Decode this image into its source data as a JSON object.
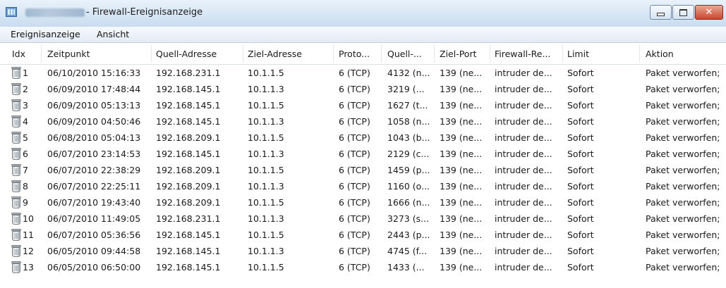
{
  "window": {
    "title": "- Firewall-Ereignisanzeige",
    "controls": {
      "minimize": "minimize",
      "maximize": "maximize",
      "close": "close"
    }
  },
  "menu": [
    "Ereignisanzeige",
    "Ansicht"
  ],
  "columns": {
    "idx": "Idx",
    "time": "Zeitpunkt",
    "src": "Quell-Adresse",
    "dst": "Ziel-Adresse",
    "proto": "Proto...",
    "sport": "Quell-...",
    "dport": "Ziel-Port",
    "rule": "Firewall-Re...",
    "limit": "Limit",
    "action": "Aktion"
  },
  "rows": [
    {
      "idx": "1",
      "time": "06/10/2010 15:16:33",
      "src": "192.168.231.1",
      "dst": "10.1.1.5",
      "proto": "6 (TCP)",
      "sport": "4132 (n...",
      "dport": "139 (ne...",
      "rule": "intruder de...",
      "limit": "Sofort",
      "action": "Paket verworfen;"
    },
    {
      "idx": "2",
      "time": "06/09/2010 17:48:44",
      "src": "192.168.145.1",
      "dst": "10.1.1.3",
      "proto": "6 (TCP)",
      "sport": "3219 (...",
      "dport": "139 (ne...",
      "rule": "intruder de...",
      "limit": "Sofort",
      "action": "Paket verworfen;"
    },
    {
      "idx": "3",
      "time": "06/09/2010 05:13:13",
      "src": "192.168.145.1",
      "dst": "10.1.1.5",
      "proto": "6 (TCP)",
      "sport": "1627 (t...",
      "dport": "139 (ne...",
      "rule": "intruder de...",
      "limit": "Sofort",
      "action": "Paket verworfen;"
    },
    {
      "idx": "4",
      "time": "06/09/2010 04:50:46",
      "src": "192.168.145.1",
      "dst": "10.1.1.3",
      "proto": "6 (TCP)",
      "sport": "1058 (n...",
      "dport": "139 (ne...",
      "rule": "intruder de...",
      "limit": "Sofort",
      "action": "Paket verworfen;"
    },
    {
      "idx": "5",
      "time": "06/08/2010 05:04:13",
      "src": "192.168.209.1",
      "dst": "10.1.1.5",
      "proto": "6 (TCP)",
      "sport": "1043 (b...",
      "dport": "139 (ne...",
      "rule": "intruder de...",
      "limit": "Sofort",
      "action": "Paket verworfen;"
    },
    {
      "idx": "6",
      "time": "06/07/2010 23:14:53",
      "src": "192.168.145.1",
      "dst": "10.1.1.3",
      "proto": "6 (TCP)",
      "sport": "2129 (c...",
      "dport": "139 (ne...",
      "rule": "intruder de...",
      "limit": "Sofort",
      "action": "Paket verworfen;"
    },
    {
      "idx": "7",
      "time": "06/07/2010 22:38:29",
      "src": "192.168.209.1",
      "dst": "10.1.1.5",
      "proto": "6 (TCP)",
      "sport": "1459 (p...",
      "dport": "139 (ne...",
      "rule": "intruder de...",
      "limit": "Sofort",
      "action": "Paket verworfen;"
    },
    {
      "idx": "8",
      "time": "06/07/2010 22:25:11",
      "src": "192.168.209.1",
      "dst": "10.1.1.3",
      "proto": "6 (TCP)",
      "sport": "1160 (o...",
      "dport": "139 (ne...",
      "rule": "intruder de...",
      "limit": "Sofort",
      "action": "Paket verworfen;"
    },
    {
      "idx": "9",
      "time": "06/07/2010 19:43:40",
      "src": "192.168.209.1",
      "dst": "10.1.1.5",
      "proto": "6 (TCP)",
      "sport": "1666 (n...",
      "dport": "139 (ne...",
      "rule": "intruder de...",
      "limit": "Sofort",
      "action": "Paket verworfen;"
    },
    {
      "idx": "10",
      "time": "06/07/2010 11:49:05",
      "src": "192.168.231.1",
      "dst": "10.1.1.3",
      "proto": "6 (TCP)",
      "sport": "3273 (s...",
      "dport": "139 (ne...",
      "rule": "intruder de...",
      "limit": "Sofort",
      "action": "Paket verworfen;"
    },
    {
      "idx": "11",
      "time": "06/07/2010 05:36:56",
      "src": "192.168.145.1",
      "dst": "10.1.1.5",
      "proto": "6 (TCP)",
      "sport": "2443 (p...",
      "dport": "139 (ne...",
      "rule": "intruder de...",
      "limit": "Sofort",
      "action": "Paket verworfen;"
    },
    {
      "idx": "12",
      "time": "06/05/2010 09:44:58",
      "src": "192.168.145.1",
      "dst": "10.1.1.3",
      "proto": "6 (TCP)",
      "sport": "4745 (f...",
      "dport": "139 (ne...",
      "rule": "intruder de...",
      "limit": "Sofort",
      "action": "Paket verworfen;"
    },
    {
      "idx": "13",
      "time": "06/05/2010 06:50:00",
      "src": "192.168.145.1",
      "dst": "10.1.1.5",
      "proto": "6 (TCP)",
      "sport": "1433 (...",
      "dport": "139 (ne...",
      "rule": "intruder de...",
      "limit": "Sofort",
      "action": "Paket verworfen;"
    }
  ],
  "icons": {
    "row": "trash-bin-icon",
    "app": "firewall-window-icon"
  },
  "colors": {
    "titlebar": "#c9dcef",
    "close": "#c9462c",
    "grid_line": "#dde3ea"
  }
}
